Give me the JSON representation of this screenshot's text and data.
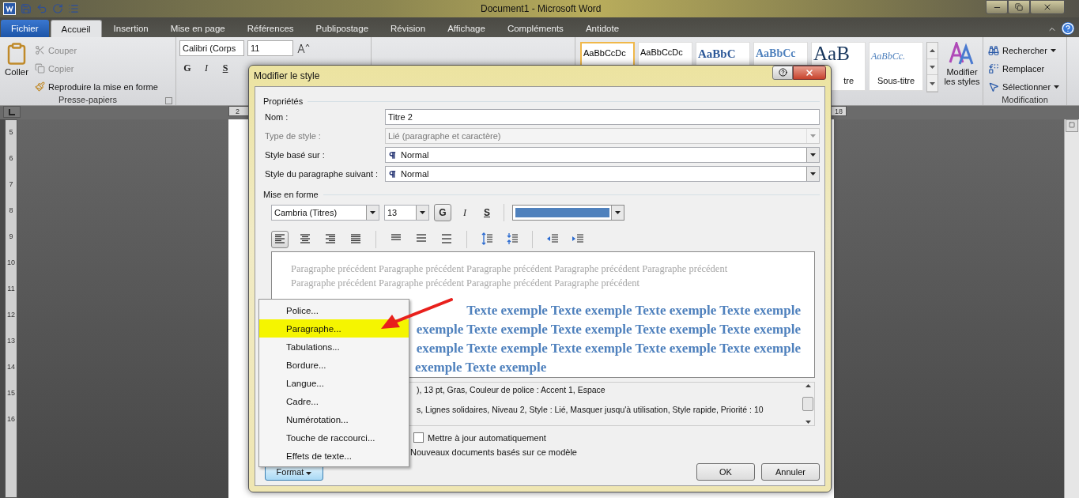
{
  "window": {
    "title": "Document1  -  Microsoft Word"
  },
  "ribbon_tabs": [
    {
      "label": "Fichier",
      "kind": "file",
      "selected": false
    },
    {
      "label": "Accueil",
      "kind": "tab",
      "selected": true
    },
    {
      "label": "Insertion",
      "kind": "tab",
      "selected": false
    },
    {
      "label": "Mise en page",
      "kind": "tab",
      "selected": false
    },
    {
      "label": "Références",
      "kind": "tab",
      "selected": false
    },
    {
      "label": "Publipostage",
      "kind": "tab",
      "selected": false
    },
    {
      "label": "Révision",
      "kind": "tab",
      "selected": false
    },
    {
      "label": "Affichage",
      "kind": "tab",
      "selected": false
    },
    {
      "label": "Compléments",
      "kind": "tab",
      "selected": false
    },
    {
      "label": "Antidote",
      "kind": "tab",
      "selected": false
    }
  ],
  "clipboard_group": {
    "paste": "Coller",
    "title": "Presse-papiers",
    "actions": [
      {
        "kind": "cut",
        "label": "Couper",
        "disabled": true
      },
      {
        "kind": "copy",
        "label": "Copier",
        "disabled": true
      },
      {
        "kind": "painter",
        "label": "Reproduire la mise en forme",
        "disabled": false
      }
    ]
  },
  "font_group": {
    "font": "Calibri (Corps",
    "size": "11",
    "format_buttons": [
      "G",
      "I",
      "S"
    ]
  },
  "styles_gallery": [
    {
      "kind": "normal",
      "sample": "AaBbCcDc",
      "selected": true
    },
    {
      "kind": "nospacing",
      "sample": "AaBbCcDc",
      "selected": false
    },
    {
      "kind": "heading1",
      "sample": "AaBbC",
      "selected": false
    },
    {
      "kind": "heading2",
      "sample": "AaBbCc",
      "selected": false
    },
    {
      "kind": "title",
      "sample": "AaB",
      "caption": "tre",
      "selected": false
    },
    {
      "kind": "subtitle",
      "sample": "AaBbCc.",
      "caption": "Sous-titre",
      "selected": false
    }
  ],
  "change_styles": {
    "label": "Modifier les styles"
  },
  "editing_group": {
    "title": "Modification",
    "actions": [
      {
        "kind": "find",
        "label": "Rechercher",
        "dropdown": true
      },
      {
        "kind": "replace",
        "label": "Remplacer",
        "dropdown": false
      },
      {
        "kind": "select",
        "label": "Sélectionner",
        "dropdown": true
      }
    ]
  },
  "rulers": {
    "horizontal": [
      "2",
      "18"
    ],
    "vertical": [
      "5",
      "6",
      "7",
      "8",
      "9",
      "10",
      "11",
      "12",
      "13",
      "14",
      "15",
      "16"
    ]
  },
  "dialog": {
    "title": "Modifier le style",
    "properties": {
      "heading": "Propriétés",
      "fields": [
        {
          "label": "Nom :",
          "value": "Titre 2",
          "kind": "text",
          "disabled": false
        },
        {
          "label": "Type de style :",
          "value": "Lié (paragraphe et caractère)",
          "kind": "select",
          "disabled": true
        },
        {
          "label": "Style basé sur :",
          "value": "Normal",
          "kind": "style-select",
          "disabled": false
        },
        {
          "label": "Style du paragraphe suivant :",
          "value": "Normal",
          "kind": "style-select",
          "disabled": false
        }
      ]
    },
    "formatting": {
      "heading": "Mise en forme",
      "font": "Cambria (Titres)",
      "size": "13",
      "color": "#4f81bd",
      "buttons": [
        {
          "label": "G",
          "kind": "bold",
          "selected": true
        },
        {
          "label": "I",
          "kind": "italic",
          "selected": false
        },
        {
          "label": "S",
          "kind": "underline",
          "selected": false
        }
      ],
      "alignment": [
        {
          "kind": "left",
          "selected": true
        },
        {
          "kind": "center",
          "selected": false
        },
        {
          "kind": "right",
          "selected": false
        },
        {
          "kind": "justify",
          "selected": false
        },
        {
          "kind": "single",
          "selected": false
        },
        {
          "kind": "one-half",
          "selected": false
        },
        {
          "kind": "double",
          "selected": false
        },
        {
          "kind": "space-more",
          "selected": false
        },
        {
          "kind": "space-less",
          "selected": false
        },
        {
          "kind": "outdent",
          "selected": false
        },
        {
          "kind": "indent",
          "selected": false
        }
      ]
    },
    "preview": {
      "previous": [
        "Paragraphe précédent Paragraphe précédent Paragraphe précédent Paragraphe précédent Paragraphe précédent",
        "Paragraphe précédent Paragraphe précédent Paragraphe précédent Paragraphe précédent"
      ],
      "sample": [
        "Texte exemple Texte exemple Texte exemple Texte exemple",
        "exemple Texte exemple Texte exemple Texte exemple Texte exemple",
        "exemple Texte exemple Texte exemple Texte exemple Texte exemple",
        "exemple Texte exemple"
      ]
    },
    "description": [
      "), 13 pt, Gras, Couleur de police : Accent 1, Espace",
      "s, Lignes solidaires, Niveau 2, Style : Lié, Masquer jusqu'à utilisation, Style rapide, Priorité : 10"
    ],
    "auto_update": {
      "label": "Mettre à jour automatiquement",
      "checked": false
    },
    "new_documents": {
      "label": "Nouveaux documents basés sur ce modèle"
    },
    "format_button": "Format",
    "ok_button": "OK",
    "cancel_button": "Annuler",
    "format_menu": [
      {
        "label": "Police...",
        "selected": false
      },
      {
        "label": "Paragraphe...",
        "selected": true
      },
      {
        "label": "Tabulations...",
        "selected": false
      },
      {
        "label": "Bordure...",
        "selected": false
      },
      {
        "label": "Langue...",
        "selected": false
      },
      {
        "label": "Cadre...",
        "selected": false
      },
      {
        "label": "Numérotation...",
        "selected": false
      },
      {
        "label": "Touche de raccourci...",
        "selected": false
      },
      {
        "label": "Effets de texte...",
        "selected": false
      }
    ]
  }
}
